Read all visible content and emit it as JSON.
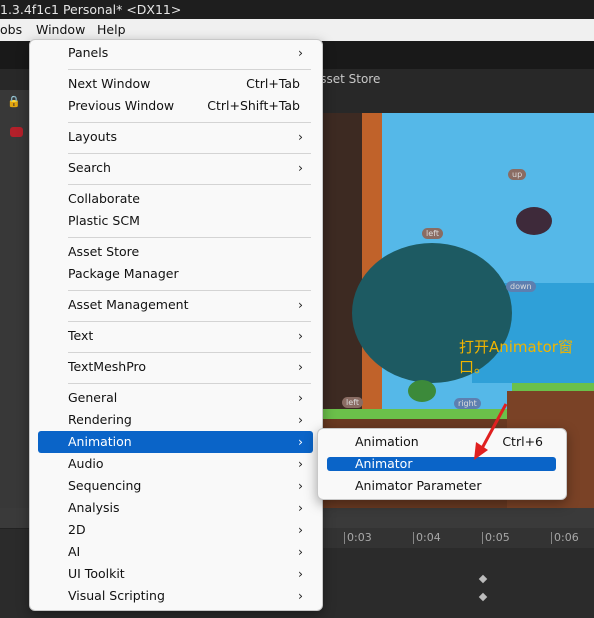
{
  "window": {
    "title": "1.3.4f1c1 Personal* <DX11>"
  },
  "menubar": {
    "items": [
      {
        "label": "obs"
      },
      {
        "label": "Window"
      },
      {
        "label": "Help"
      }
    ]
  },
  "tab": {
    "asset_store": "Asset Store"
  },
  "window_menu": {
    "items": [
      {
        "label": "Panels",
        "shortcut": "",
        "submenu": true
      },
      {
        "label": "Next Window",
        "shortcut": "Ctrl+Tab",
        "submenu": false
      },
      {
        "label": "Previous Window",
        "shortcut": "Ctrl+Shift+Tab",
        "submenu": false
      },
      {
        "label": "Layouts",
        "shortcut": "",
        "submenu": true
      },
      {
        "label": "Search",
        "shortcut": "",
        "submenu": true
      },
      {
        "label": "Collaborate",
        "shortcut": "",
        "submenu": false
      },
      {
        "label": "Plastic SCM",
        "shortcut": "",
        "submenu": false
      },
      {
        "label": "Asset Store",
        "shortcut": "",
        "submenu": false
      },
      {
        "label": "Package Manager",
        "shortcut": "",
        "submenu": false
      },
      {
        "label": "Asset Management",
        "shortcut": "",
        "submenu": true
      },
      {
        "label": "Text",
        "shortcut": "",
        "submenu": true
      },
      {
        "label": "TextMeshPro",
        "shortcut": "",
        "submenu": true
      },
      {
        "label": "General",
        "shortcut": "",
        "submenu": true
      },
      {
        "label": "Rendering",
        "shortcut": "",
        "submenu": true
      },
      {
        "label": "Animation",
        "shortcut": "",
        "submenu": true,
        "highlighted": true
      },
      {
        "label": "Audio",
        "shortcut": "",
        "submenu": true
      },
      {
        "label": "Sequencing",
        "shortcut": "",
        "submenu": true
      },
      {
        "label": "Analysis",
        "shortcut": "",
        "submenu": true
      },
      {
        "label": "2D",
        "shortcut": "",
        "submenu": true
      },
      {
        "label": "AI",
        "shortcut": "",
        "submenu": true
      },
      {
        "label": "UI Toolkit",
        "shortcut": "",
        "submenu": true
      },
      {
        "label": "Visual Scripting",
        "shortcut": "",
        "submenu": true
      }
    ]
  },
  "animation_submenu": {
    "items": [
      {
        "label": "Animation",
        "shortcut": "Ctrl+6"
      },
      {
        "label": "Animator",
        "shortcut": "",
        "highlighted": true
      },
      {
        "label": "Animator Parameter",
        "shortcut": ""
      }
    ]
  },
  "annotation": {
    "text": "打开Animator窗口。"
  },
  "scene": {
    "labels": {
      "up": "up",
      "left": "left",
      "down": "down",
      "right": "right",
      "left2": "left"
    }
  },
  "timeline": {
    "ticks": [
      "0:03",
      "0:04",
      "0:05",
      "0:06"
    ]
  },
  "colors": {
    "highlight": "#0a64c8",
    "annotation": "#f0b400",
    "arrow": "#e02020"
  }
}
